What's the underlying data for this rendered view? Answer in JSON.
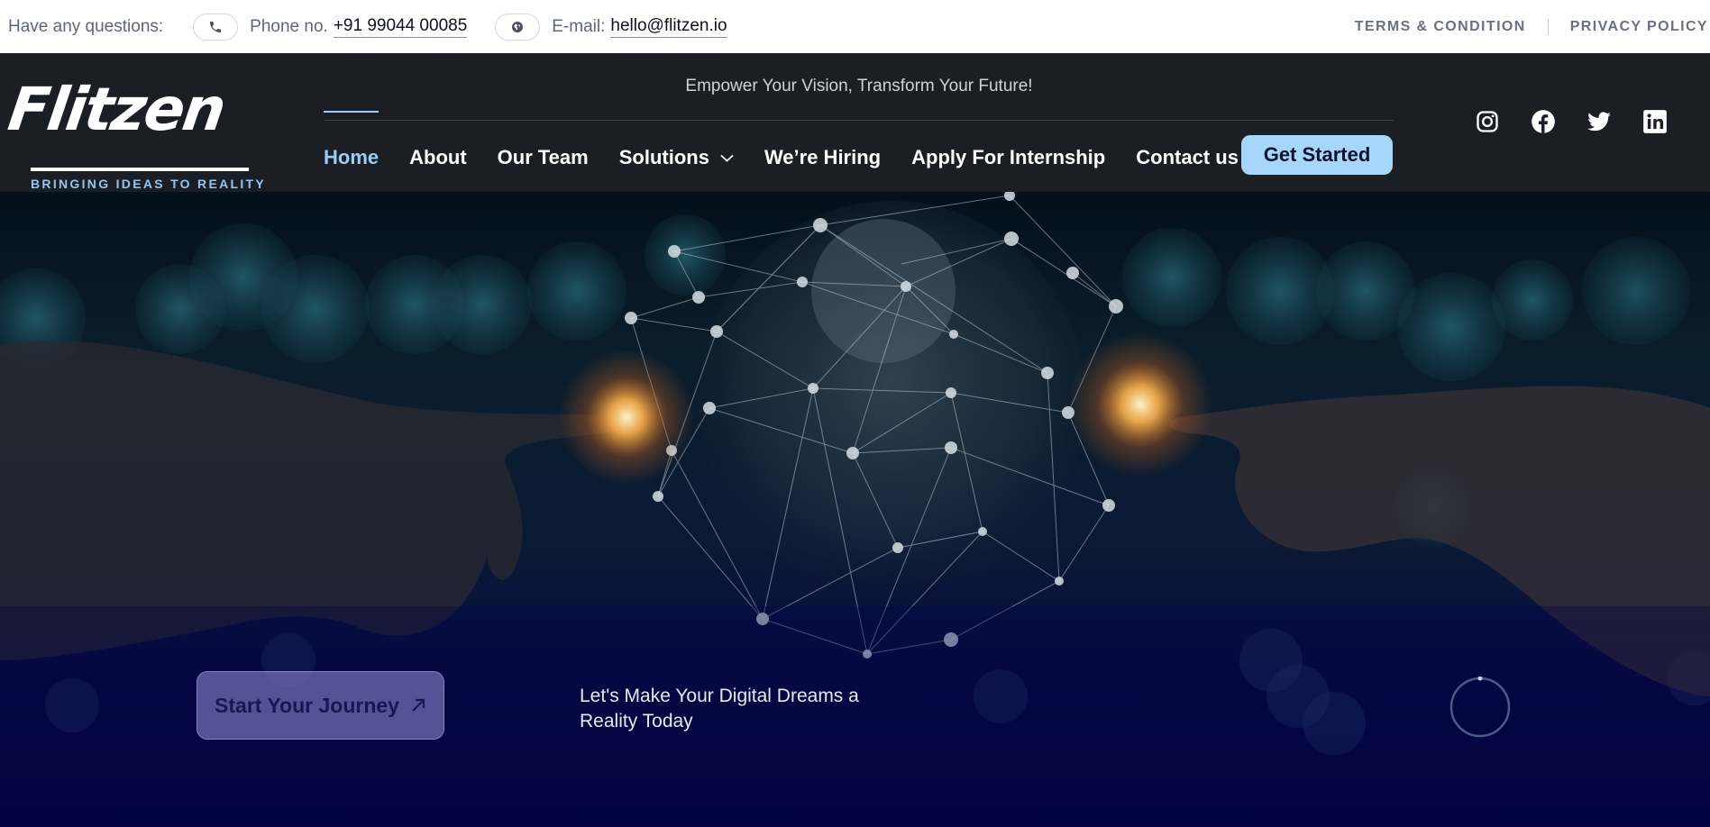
{
  "topbar": {
    "question": "Have any questions:",
    "phone_label": "Phone no.",
    "phone_value": "+91 99044 00085",
    "email_label": "E-mail:",
    "email_value": "hello@flitzen.io",
    "terms": "TERMS & CONDITION",
    "privacy": "PRIVACY POLICY",
    "icons": [
      "phone-icon",
      "globe-icon"
    ]
  },
  "header": {
    "logo_text": "Flitzen",
    "logo_tagline": "BRINGING IDEAS TO REALITY",
    "tagline": "Empower Your Vision, Transform Your Future!",
    "nav": [
      {
        "label": "Home",
        "active": true
      },
      {
        "label": "About"
      },
      {
        "label": "Our Team"
      },
      {
        "label": "Solutions",
        "dropdown": true
      },
      {
        "label": "We’re Hiring"
      },
      {
        "label": "Apply For Internship"
      },
      {
        "label": "Contact us"
      }
    ],
    "cta": "Get Started",
    "socials": [
      "instagram-icon",
      "facebook-icon",
      "twitter-icon",
      "linkedin-icon"
    ]
  },
  "hero": {
    "button": "Start Your Journey",
    "subtitle": "Let's Make Your Digital Dreams a Reality Today"
  },
  "colors": {
    "accent": "#9ccef5",
    "cta_bg": "#a7d6fb",
    "header_bg": "#1c1f23",
    "hero_bottom": "#03033b"
  }
}
